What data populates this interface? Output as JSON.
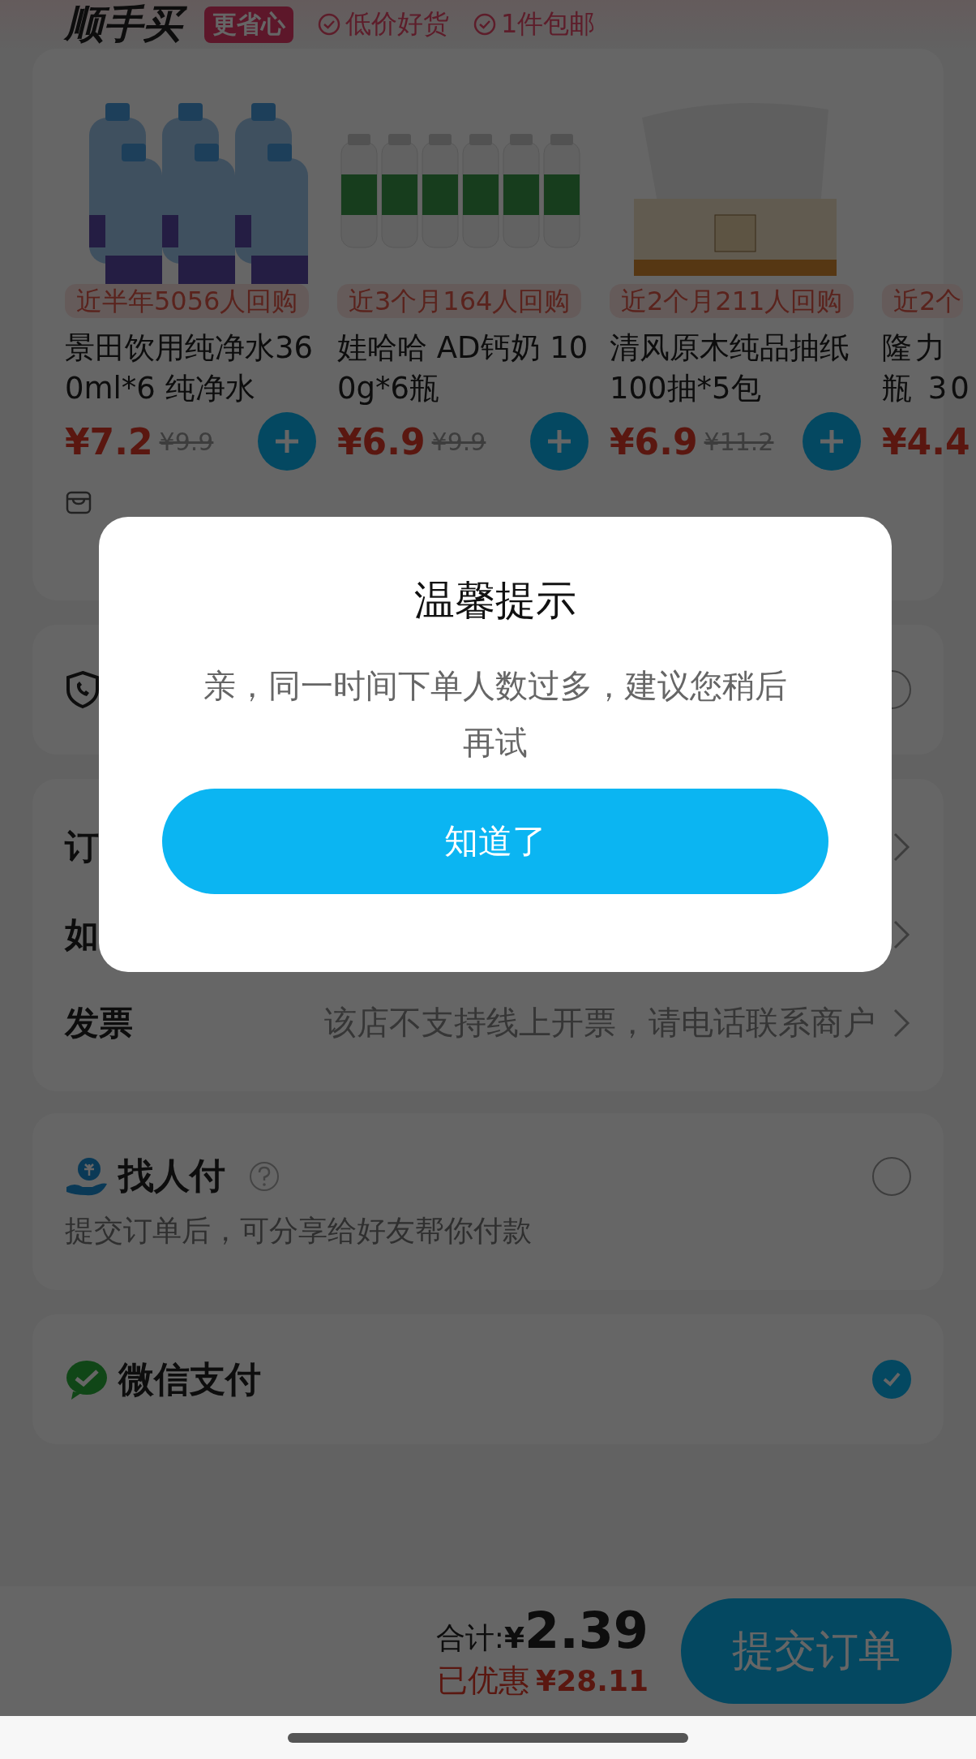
{
  "header": {
    "title": "顺手买",
    "badge": "更省心",
    "features": [
      "低价好货",
      "1件包邮"
    ]
  },
  "products": [
    {
      "kind": "water",
      "badge": "近半年5056人回购",
      "name": "景田饮用纯净水360ml*6 纯净水",
      "price": "¥7.2",
      "original_price": "¥9.9"
    },
    {
      "kind": "milk",
      "badge": "近3个月164人回购",
      "name": "娃哈哈 AD钙奶 100g*6瓶",
      "price": "¥6.9",
      "original_price": "¥9.9"
    },
    {
      "kind": "tissue",
      "badge": "近2个月211人回购",
      "name": "清风原木纯品抽纸 100抽*5包",
      "price": "¥6.9",
      "original_price": "¥11.2"
    },
    {
      "kind": "partial",
      "badge": "近2个",
      "name": "隆力瓶 30",
      "price": "¥4.4"
    }
  ],
  "protection": {
    "checked": false
  },
  "order_rows": [
    {
      "label": "订"
    },
    {
      "label": "如"
    },
    {
      "label": "发票",
      "value": "该店不支持线上开票，请电话联系商户"
    }
  ],
  "payments": [
    {
      "kind": "friend",
      "title": "找人付",
      "subtitle": "提交订单后，可分享给好友帮你付款",
      "selected": false
    },
    {
      "kind": "wechat",
      "title": "微信支付",
      "selected": true
    }
  ],
  "footer": {
    "total_label": "合计:",
    "currency": "¥",
    "total": "2.39",
    "discount_label": "已优惠",
    "discount": "¥28.11",
    "submit": "提交订单"
  },
  "dialog": {
    "title": "温馨提示",
    "message": "亲，同一时间下单人数过多，建议您稍后再试",
    "button": "知道了"
  }
}
